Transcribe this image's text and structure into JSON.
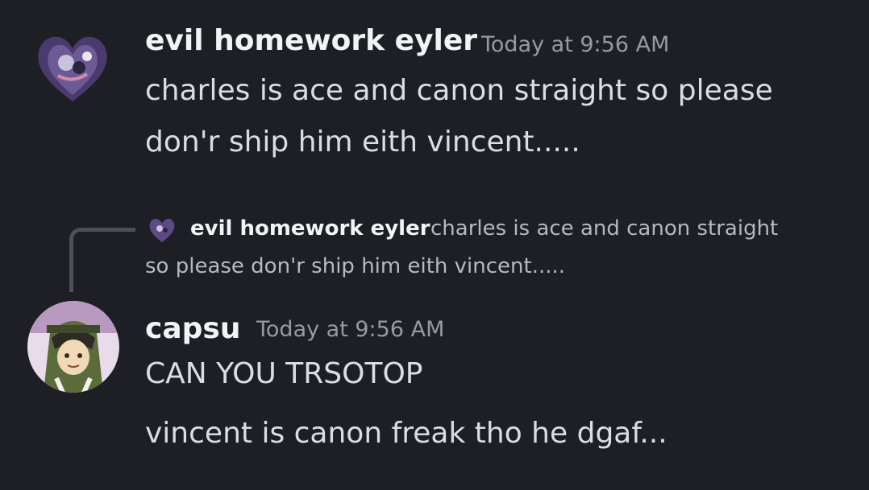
{
  "messages": [
    {
      "username": "evil homework eyler",
      "timestamp": "Today at 9:56 AM",
      "lines": [
        "charles is ace and canon straight so please",
        "don'r ship him eith vincent....."
      ]
    },
    {
      "reply": {
        "username": "evil homework eyler",
        "text_line1": "charles is ace and canon straight",
        "text_line2": "so please don'r ship him eith vincent....."
      },
      "username": "capsu",
      "timestamp": "Today at 9:56 AM",
      "lines": [
        "CAN YOU TRSOTOP",
        "vincent is canon freak tho he dgaf..."
      ]
    }
  ],
  "colors": {
    "background": "#1e1f24",
    "username": "#f2f3f5",
    "timestamp": "#949ba4",
    "message_text": "#dbdee1",
    "reply_text": "#b5bac1",
    "reply_connector": "#4e5058"
  },
  "icons": {
    "avatar_1": "purple-heart-avatar",
    "avatar_2": "capsu-avatar"
  }
}
